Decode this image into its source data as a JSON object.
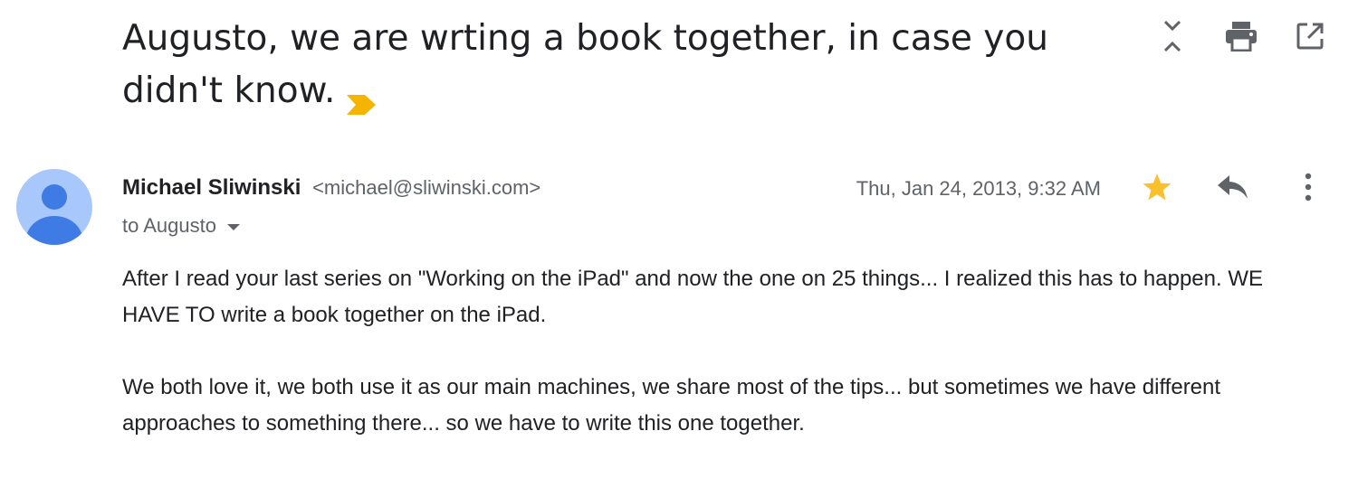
{
  "subject": "Augusto, we are wrting a book together, in case you didn't know.",
  "toolbar": {
    "collapse_icon": "collapse-icon",
    "print_icon": "print-icon",
    "open_new_window_icon": "open-in-new-window-icon"
  },
  "message": {
    "sender_name": "Michael Sliwinski",
    "sender_email": "<michael@sliwinski.com>",
    "date": "Thu, Jan 24, 2013, 9:32 AM",
    "recipient": "to Augusto",
    "starred": true,
    "paragraphs": [
      "After I read your last series on \"Working on the iPad\" and now the one on 25 things... I realized this has to happen. WE HAVE TO write a book together on the iPad.",
      "We both love it, we both use it as our main machines, we share most of the tips... but sometimes we have different approaches to something there... so we have to write this one together."
    ]
  },
  "colors": {
    "importance_marker": "#f4b400",
    "star": "#fbc02d",
    "avatar_bg": "#a8c7fa",
    "avatar_fg": "#3f7be4",
    "icon_gray": "#5f6368"
  }
}
